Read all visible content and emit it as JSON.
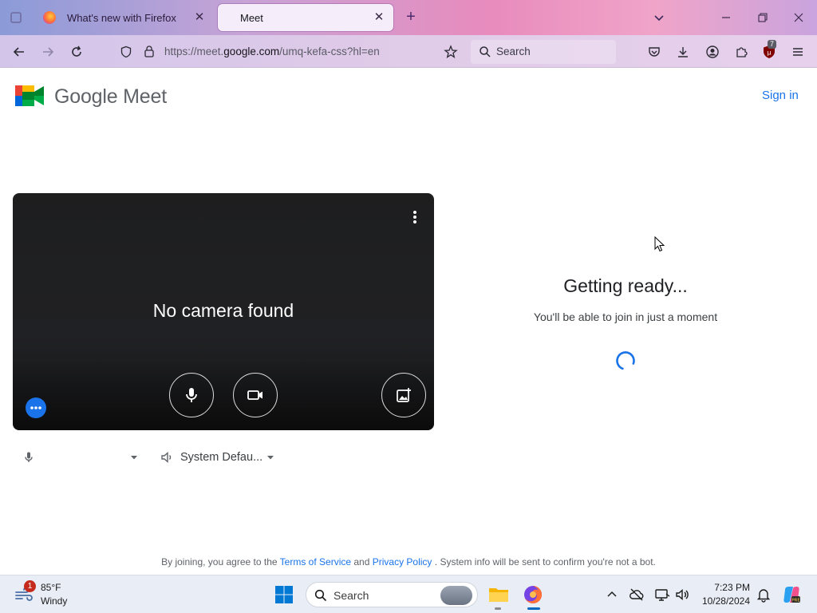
{
  "browser": {
    "tabs": [
      {
        "title": "What's new with Firefox",
        "active": false
      },
      {
        "title": "Meet",
        "active": true
      }
    ],
    "url_prefix": "https://meet.",
    "url_domain": "google.com",
    "url_path": "/umq-kefa-css?hl=en",
    "search_placeholder": "Search",
    "extension_badge": "7"
  },
  "meet": {
    "brand": "Google Meet",
    "sign_in": "Sign in",
    "preview_message": "No camera found",
    "mic_device": "",
    "speaker_device": "System Defau...",
    "ready_title": "Getting ready...",
    "ready_subtitle": "You'll be able to join in just a moment",
    "terms": {
      "prefix": "By joining, you agree to the",
      "tos": "Terms of Service",
      "and": "and",
      "privacy": "Privacy Policy",
      "suffix": ". System info will be sent to confirm you're not a bot."
    }
  },
  "taskbar": {
    "weather_temp": "85°F",
    "weather_cond": "Windy",
    "weather_badge": "1",
    "search_label": "Search",
    "time": "7:23 PM",
    "date": "10/28/2024"
  }
}
